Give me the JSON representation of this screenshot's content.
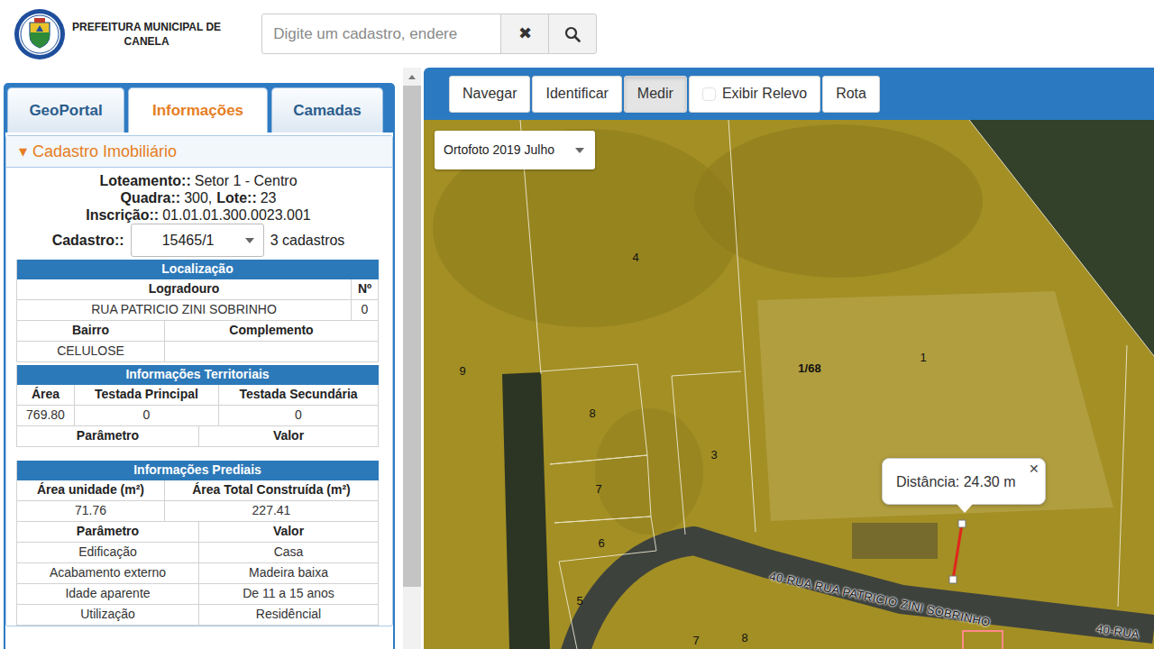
{
  "header": {
    "title": [
      "PREFEITURA MUNICIPAL DE",
      "CANELA"
    ],
    "search": {
      "placeholder": "Digite um cadastro, endere",
      "clear": "✖"
    }
  },
  "tabs": [
    {
      "label": "GeoPortal",
      "selected": false
    },
    {
      "label": "Informações",
      "selected": true
    },
    {
      "label": "Camadas",
      "selected": false
    }
  ],
  "section": {
    "toggle": "▾",
    "title": "Cadastro Imobiliário",
    "expanded": true
  },
  "summary": [
    [
      {
        "label": "Loteamento::",
        "value": "Setor 1 - Centro"
      }
    ],
    [
      {
        "label": "Quadra::",
        "value": "300,"
      },
      {
        "label": "Lote::",
        "value": "23"
      }
    ],
    [
      {
        "label": "Inscrição::",
        "value": "01.01.01.300.0023.001"
      }
    ]
  ],
  "cadastro": {
    "label": "Cadastro::",
    "value": "15465/1",
    "count": "3 cadastros"
  },
  "tables": [
    {
      "title": "Localização",
      "rows": [
        {
          "kind": "head",
          "cells": [
            "Logradouro",
            "Nº"
          ]
        },
        {
          "kind": "data",
          "cells": [
            "RUA PATRICIO ZINI SOBRINHO",
            "0"
          ]
        },
        {
          "kind": "head",
          "cells": [
            "Bairro",
            "Complemento"
          ]
        },
        {
          "kind": "data",
          "cells": [
            "CELULOSE",
            ""
          ]
        }
      ]
    },
    {
      "title": "Informações Territoriais",
      "rows": [
        {
          "kind": "head",
          "cells": [
            "Área",
            "Testada Principal",
            "Testada Secundária"
          ]
        },
        {
          "kind": "data",
          "cells": [
            "769.80",
            "0",
            "0"
          ]
        },
        {
          "kind": "head",
          "cells": [
            "Parâmetro",
            "Valor"
          ]
        }
      ]
    },
    {
      "title": "Informações Prediais",
      "rows": [
        {
          "kind": "head",
          "cells": [
            "Área unidade (m²)",
            "Área Total Construída (m²)"
          ]
        },
        {
          "kind": "data",
          "cells": [
            "71.76",
            "227.41"
          ]
        },
        {
          "kind": "head",
          "cells": [
            "Parâmetro",
            "Valor"
          ]
        },
        {
          "kind": "data",
          "cells": [
            "Edificação",
            "Casa"
          ]
        },
        {
          "kind": "data",
          "cells": [
            "Acabamento externo",
            "Madeira baixa"
          ]
        },
        {
          "kind": "data",
          "cells": [
            "Idade aparente",
            "De 11 a 15 anos"
          ]
        },
        {
          "kind": "data",
          "cells": [
            "Utilização",
            "Residêncial"
          ]
        }
      ]
    }
  ],
  "scrollbar": {
    "level": 0.89
  },
  "toolbar": [
    {
      "kind": "button",
      "label": "Navegar",
      "selected": false
    },
    {
      "kind": "button",
      "label": "Identificar",
      "selected": false
    },
    {
      "kind": "button",
      "label": "Medir",
      "selected": true
    },
    {
      "kind": "checkbox",
      "label": "Exibir Relevo",
      "checked": false
    },
    {
      "kind": "button",
      "label": "Rota",
      "selected": false
    }
  ],
  "map": {
    "layer": "Ortofoto 2019 Julho",
    "lot_labels": [
      {
        "text": "4",
        "bold": false
      },
      {
        "text": "9",
        "bold": false
      },
      {
        "text": "1/68",
        "bold": true
      },
      {
        "text": "1",
        "bold": false
      },
      {
        "text": "8",
        "bold": false
      },
      {
        "text": "3",
        "bold": false
      },
      {
        "text": "7",
        "bold": false
      },
      {
        "text": "6",
        "bold": false
      },
      {
        "text": "5",
        "bold": false
      },
      {
        "text": "7",
        "bold": false
      },
      {
        "text": "8",
        "bold": false
      }
    ],
    "street_labels": [
      "40-RUA RUA PATRICIO ZINI SOBRINHO",
      "40-RUA"
    ],
    "measurement": {
      "text": "Distância: 24.30 m",
      "close": "✕"
    }
  }
}
